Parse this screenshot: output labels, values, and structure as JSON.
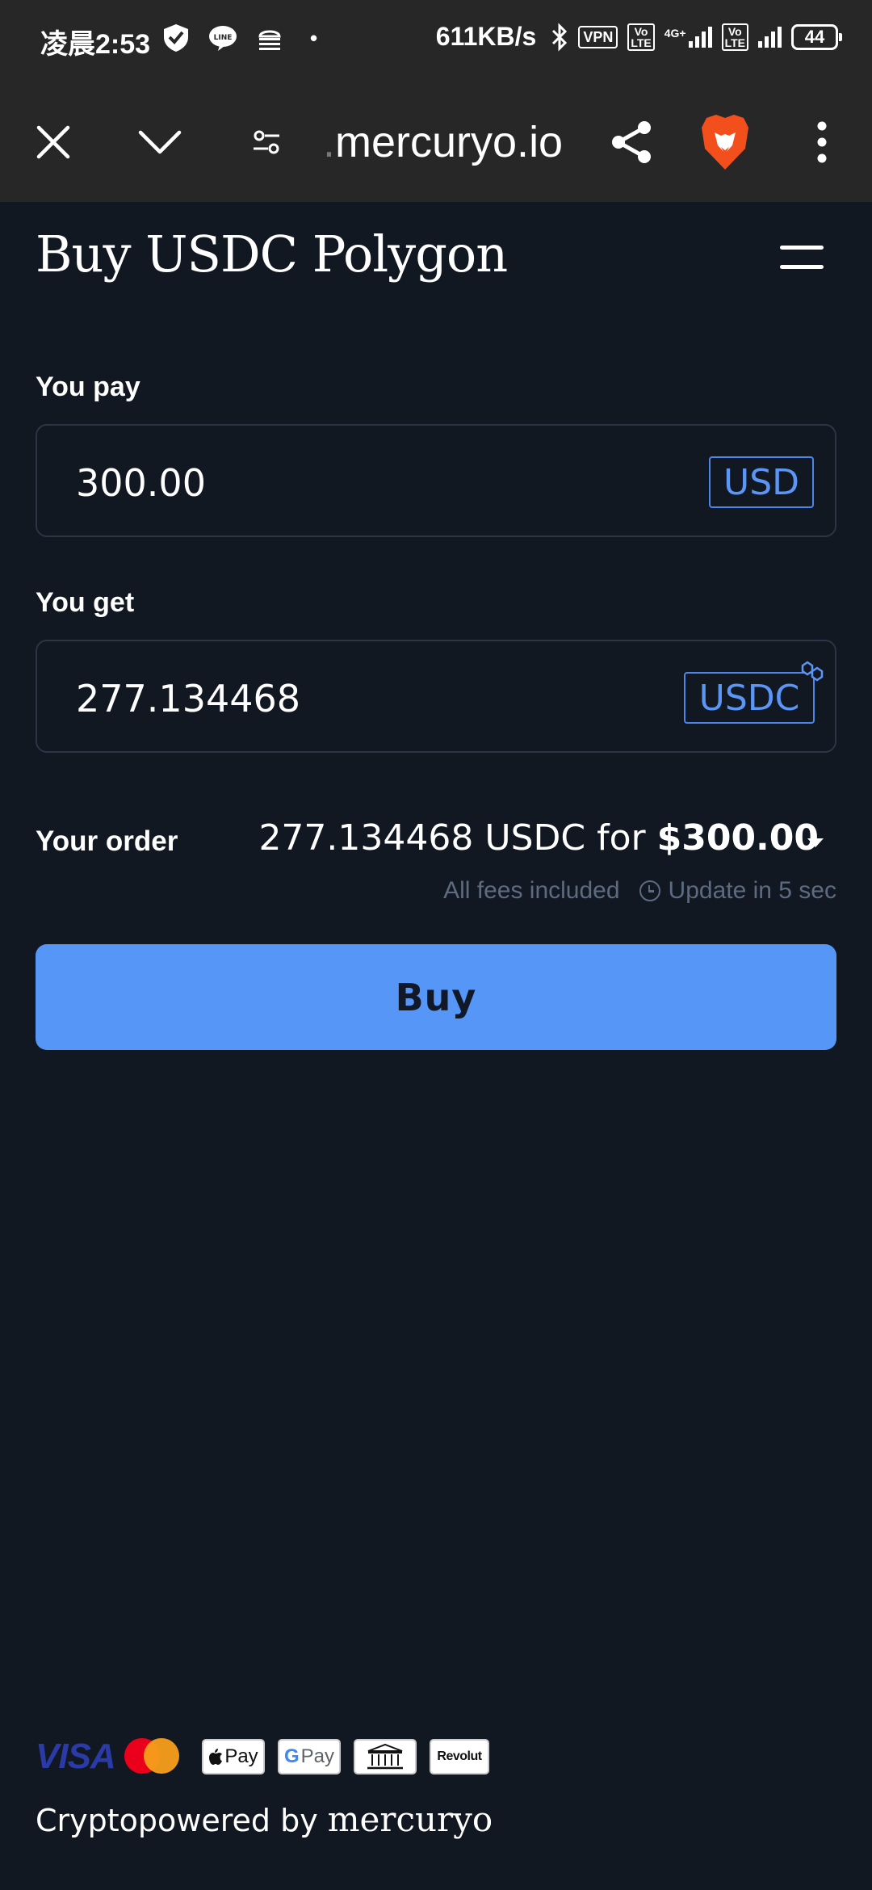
{
  "status_bar": {
    "time": "凌晨2:53",
    "dot": "•",
    "net_rate": "611KB/s",
    "vpn": "VPN",
    "volte": "Vo\nLTE",
    "network": "4G+",
    "battery": "44"
  },
  "browser": {
    "url_prefix": ".",
    "url": "mercuryo.io",
    "icons": [
      "close-icon",
      "chevron-down-icon",
      "site-settings-icon",
      "share-icon",
      "brave-lion-icon",
      "more-vert-icon"
    ]
  },
  "page": {
    "title": "Buy USDC Polygon",
    "pay": {
      "label": "You pay",
      "value": "300.00",
      "currency": "USD"
    },
    "get": {
      "label": "You get",
      "value": "277.134468",
      "currency": "USDC"
    },
    "order": {
      "label": "Your order",
      "summary": "277.134468 USDC for",
      "amount": "$300.00",
      "fees": "All fees included",
      "update": "Update in 5 sec"
    },
    "buy_label": "Buy"
  },
  "footer": {
    "payment_methods": {
      "visa": "VISA",
      "apple_pay": "Pay",
      "google_pay": "Pay",
      "revolut": "Revolut"
    },
    "powered_by": "Cryptopowered by",
    "brand": "mercuryo"
  },
  "colors": {
    "background": "#121822",
    "accent": "#5596f7",
    "muted": "#5d6b80",
    "toolbar": "#272727"
  }
}
